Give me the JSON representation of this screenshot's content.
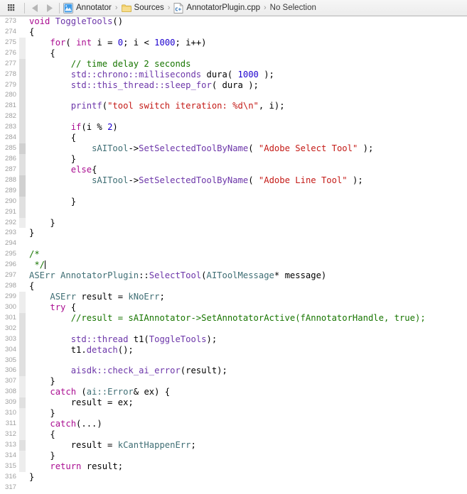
{
  "window": {
    "title": "AnnotatorPlugin.cpp",
    "app": "Xcode"
  },
  "jumpbar": {
    "grid_icon": "related-items-grid-icon",
    "back_label": "◀",
    "forward_label": "▶",
    "crumbs": [
      {
        "icon": "project-icon",
        "label": "Annotator"
      },
      {
        "icon": "folder-icon",
        "label": "Sources"
      },
      {
        "icon": "cpp-file-icon",
        "label": "AnnotatorPlugin.cpp"
      },
      {
        "icon": "none",
        "label": "No Selection"
      }
    ],
    "separator": "›"
  },
  "colors": {
    "keyword": "#aa0d91",
    "number": "#1c00cf",
    "string": "#c41a16",
    "comment": "#177500",
    "type": "#3f6e74",
    "method": "#6c36a9",
    "plain": "#000000",
    "line_number": "#a0a0a0",
    "background": "#ffffff",
    "jumpbar_border": "#b4b4b4"
  },
  "editor": {
    "first_line": 273,
    "last_line": 317,
    "cursor_line": 296,
    "lines": [
      {
        "n": 273,
        "depth": 0,
        "tokens": [
          {
            "t": "k",
            "v": "void"
          },
          {
            "t": "p",
            "v": " "
          },
          {
            "t": "m",
            "v": "ToggleTools"
          },
          {
            "t": "p",
            "v": "()"
          }
        ]
      },
      {
        "n": 274,
        "depth": 0,
        "tokens": [
          {
            "t": "p",
            "v": "{"
          }
        ]
      },
      {
        "n": 275,
        "depth": 1,
        "tokens": [
          {
            "t": "p",
            "v": "    "
          },
          {
            "t": "k",
            "v": "for"
          },
          {
            "t": "p",
            "v": "( "
          },
          {
            "t": "k",
            "v": "int"
          },
          {
            "t": "p",
            "v": " i = "
          },
          {
            "t": "n",
            "v": "0"
          },
          {
            "t": "p",
            "v": "; i < "
          },
          {
            "t": "n",
            "v": "1000"
          },
          {
            "t": "p",
            "v": "; i++)"
          }
        ]
      },
      {
        "n": 276,
        "depth": 1,
        "tokens": [
          {
            "t": "p",
            "v": "    {"
          }
        ]
      },
      {
        "n": 277,
        "depth": 2,
        "tokens": [
          {
            "t": "p",
            "v": "        "
          },
          {
            "t": "c",
            "v": "// time delay 2 seconds"
          }
        ]
      },
      {
        "n": 278,
        "depth": 2,
        "tokens": [
          {
            "t": "p",
            "v": "        "
          },
          {
            "t": "m",
            "v": "std::chrono::milliseconds"
          },
          {
            "t": "p",
            "v": " dura( "
          },
          {
            "t": "n",
            "v": "1000"
          },
          {
            "t": "p",
            "v": " );"
          }
        ]
      },
      {
        "n": 279,
        "depth": 2,
        "tokens": [
          {
            "t": "p",
            "v": "        "
          },
          {
            "t": "m",
            "v": "std::this_thread::sleep_for"
          },
          {
            "t": "p",
            "v": "( dura );"
          }
        ]
      },
      {
        "n": 280,
        "depth": 2,
        "tokens": []
      },
      {
        "n": 281,
        "depth": 2,
        "tokens": [
          {
            "t": "p",
            "v": "        "
          },
          {
            "t": "m",
            "v": "printf"
          },
          {
            "t": "p",
            "v": "("
          },
          {
            "t": "s",
            "v": "\"tool switch iteration: %d\\n\""
          },
          {
            "t": "p",
            "v": ", i);"
          }
        ]
      },
      {
        "n": 282,
        "depth": 2,
        "tokens": []
      },
      {
        "n": 283,
        "depth": 2,
        "tokens": [
          {
            "t": "p",
            "v": "        "
          },
          {
            "t": "k",
            "v": "if"
          },
          {
            "t": "p",
            "v": "(i % "
          },
          {
            "t": "n",
            "v": "2"
          },
          {
            "t": "p",
            "v": ")"
          }
        ]
      },
      {
        "n": 284,
        "depth": 2,
        "tokens": [
          {
            "t": "p",
            "v": "        {"
          }
        ]
      },
      {
        "n": 285,
        "depth": 3,
        "tokens": [
          {
            "t": "p",
            "v": "            "
          },
          {
            "t": "t",
            "v": "sAITool"
          },
          {
            "t": "p",
            "v": "->"
          },
          {
            "t": "m",
            "v": "SetSelectedToolByName"
          },
          {
            "t": "p",
            "v": "( "
          },
          {
            "t": "s",
            "v": "\"Adobe Select Tool\""
          },
          {
            "t": "p",
            "v": " );"
          }
        ]
      },
      {
        "n": 286,
        "depth": 2,
        "tokens": [
          {
            "t": "p",
            "v": "        }"
          }
        ]
      },
      {
        "n": 287,
        "depth": 2,
        "tokens": [
          {
            "t": "p",
            "v": "        "
          },
          {
            "t": "k",
            "v": "else"
          },
          {
            "t": "p",
            "v": "{"
          }
        ]
      },
      {
        "n": 288,
        "depth": 3,
        "tokens": [
          {
            "t": "p",
            "v": "            "
          },
          {
            "t": "t",
            "v": "sAITool"
          },
          {
            "t": "p",
            "v": "->"
          },
          {
            "t": "m",
            "v": "SetSelectedToolByName"
          },
          {
            "t": "p",
            "v": "( "
          },
          {
            "t": "s",
            "v": "\"Adobe Line Tool\""
          },
          {
            "t": "p",
            "v": " );"
          }
        ]
      },
      {
        "n": 289,
        "depth": 3,
        "tokens": []
      },
      {
        "n": 290,
        "depth": 2,
        "tokens": [
          {
            "t": "p",
            "v": "        }"
          }
        ]
      },
      {
        "n": 291,
        "depth": 2,
        "tokens": []
      },
      {
        "n": 292,
        "depth": 1,
        "tokens": [
          {
            "t": "p",
            "v": "    }"
          }
        ]
      },
      {
        "n": 293,
        "depth": 0,
        "tokens": [
          {
            "t": "p",
            "v": "}"
          }
        ]
      },
      {
        "n": 294,
        "depth": 0,
        "tokens": []
      },
      {
        "n": 295,
        "depth": 0,
        "tokens": [
          {
            "t": "c",
            "v": "/*"
          }
        ]
      },
      {
        "n": 296,
        "depth": 0,
        "tokens": [
          {
            "t": "c",
            "v": " */"
          }
        ],
        "cursor": true
      },
      {
        "n": 297,
        "depth": 0,
        "tokens": [
          {
            "t": "t",
            "v": "ASErr"
          },
          {
            "t": "p",
            "v": " "
          },
          {
            "t": "t",
            "v": "AnnotatorPlugin"
          },
          {
            "t": "p",
            "v": "::"
          },
          {
            "t": "m",
            "v": "SelectTool"
          },
          {
            "t": "p",
            "v": "("
          },
          {
            "t": "t",
            "v": "AIToolMessage"
          },
          {
            "t": "p",
            "v": "* message)"
          }
        ]
      },
      {
        "n": 298,
        "depth": 0,
        "tokens": [
          {
            "t": "p",
            "v": "{"
          }
        ]
      },
      {
        "n": 299,
        "depth": 1,
        "tokens": [
          {
            "t": "p",
            "v": "    "
          },
          {
            "t": "t",
            "v": "ASErr"
          },
          {
            "t": "p",
            "v": " result = "
          },
          {
            "t": "t",
            "v": "kNoErr"
          },
          {
            "t": "p",
            "v": ";"
          }
        ]
      },
      {
        "n": 300,
        "depth": 1,
        "tokens": [
          {
            "t": "p",
            "v": "    "
          },
          {
            "t": "k",
            "v": "try"
          },
          {
            "t": "p",
            "v": " {"
          }
        ]
      },
      {
        "n": 301,
        "depth": 2,
        "tokens": [
          {
            "t": "p",
            "v": "        "
          },
          {
            "t": "c",
            "v": "//result = sAIAnnotator->SetAnnotatorActive(fAnnotatorHandle, true);"
          }
        ]
      },
      {
        "n": 302,
        "depth": 2,
        "tokens": []
      },
      {
        "n": 303,
        "depth": 2,
        "tokens": [
          {
            "t": "p",
            "v": "        "
          },
          {
            "t": "m",
            "v": "std::thread"
          },
          {
            "t": "p",
            "v": " t1("
          },
          {
            "t": "m",
            "v": "ToggleTools"
          },
          {
            "t": "p",
            "v": ");"
          }
        ]
      },
      {
        "n": 304,
        "depth": 2,
        "tokens": [
          {
            "t": "p",
            "v": "        t1."
          },
          {
            "t": "m",
            "v": "detach"
          },
          {
            "t": "p",
            "v": "();"
          }
        ]
      },
      {
        "n": 305,
        "depth": 2,
        "tokens": []
      },
      {
        "n": 306,
        "depth": 2,
        "tokens": [
          {
            "t": "p",
            "v": "        "
          },
          {
            "t": "m",
            "v": "aisdk::check_ai_error"
          },
          {
            "t": "p",
            "v": "(result);"
          }
        ]
      },
      {
        "n": 307,
        "depth": 1,
        "tokens": [
          {
            "t": "p",
            "v": "    }"
          }
        ]
      },
      {
        "n": 308,
        "depth": 1,
        "tokens": [
          {
            "t": "p",
            "v": "    "
          },
          {
            "t": "k",
            "v": "catch"
          },
          {
            "t": "p",
            "v": " ("
          },
          {
            "t": "t",
            "v": "ai::Error"
          },
          {
            "t": "p",
            "v": "& ex) {"
          }
        ]
      },
      {
        "n": 309,
        "depth": 2,
        "tokens": [
          {
            "t": "p",
            "v": "        result = ex;"
          }
        ]
      },
      {
        "n": 310,
        "depth": 1,
        "tokens": [
          {
            "t": "p",
            "v": "    }"
          }
        ]
      },
      {
        "n": 311,
        "depth": 1,
        "tokens": [
          {
            "t": "p",
            "v": "    "
          },
          {
            "t": "k",
            "v": "catch"
          },
          {
            "t": "p",
            "v": "(...)"
          }
        ]
      },
      {
        "n": 312,
        "depth": 1,
        "tokens": [
          {
            "t": "p",
            "v": "    {"
          }
        ]
      },
      {
        "n": 313,
        "depth": 2,
        "tokens": [
          {
            "t": "p",
            "v": "        result = "
          },
          {
            "t": "t",
            "v": "kCantHappenErr"
          },
          {
            "t": "p",
            "v": ";"
          }
        ]
      },
      {
        "n": 314,
        "depth": 1,
        "tokens": [
          {
            "t": "p",
            "v": "    }"
          }
        ]
      },
      {
        "n": 315,
        "depth": 1,
        "tokens": [
          {
            "t": "p",
            "v": "    "
          },
          {
            "t": "k",
            "v": "return"
          },
          {
            "t": "p",
            "v": " result;"
          }
        ]
      },
      {
        "n": 316,
        "depth": 0,
        "tokens": [
          {
            "t": "p",
            "v": "}"
          }
        ]
      },
      {
        "n": 317,
        "depth": 0,
        "tokens": []
      }
    ]
  }
}
